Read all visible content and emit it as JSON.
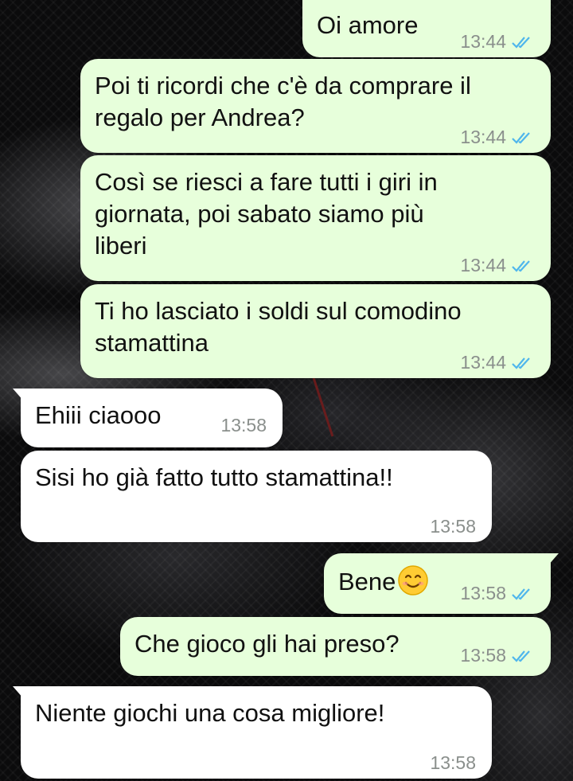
{
  "colors": {
    "outgoing_bubble": "#e7ffdb",
    "incoming_bubble": "#ffffff",
    "read_ticks": "#4fb6ec",
    "timestamp": "#8a8f8c"
  },
  "messages": [
    {
      "id": "m1",
      "direction": "outgoing",
      "text": "Oi amore",
      "time": "13:44",
      "status_icon": "double-check-read-icon"
    },
    {
      "id": "m2",
      "direction": "outgoing",
      "lines": [
        "Poi ti ricordi che c'è da comprare il",
        "regalo per Andrea?"
      ],
      "time": "13:44",
      "status_icon": "double-check-read-icon"
    },
    {
      "id": "m3",
      "direction": "outgoing",
      "lines": [
        "Così se riesci a fare tutti i giri in",
        "giornata, poi sabato siamo più",
        "liberi"
      ],
      "time": "13:44",
      "status_icon": "double-check-read-icon"
    },
    {
      "id": "m4",
      "direction": "outgoing",
      "lines": [
        "Ti ho lasciato i soldi sul comodino",
        "stamattina"
      ],
      "time": "13:44",
      "status_icon": "double-check-read-icon"
    },
    {
      "id": "m5",
      "direction": "incoming",
      "text": "Ehiii ciaooo",
      "time": "13:58"
    },
    {
      "id": "m6",
      "direction": "incoming",
      "text": "Sisi ho già fatto tutto stamattina!!",
      "time": "13:58"
    },
    {
      "id": "m7",
      "direction": "outgoing",
      "text": "Bene",
      "emoji": "smiling-face-icon",
      "time": "13:58",
      "status_icon": "double-check-read-icon"
    },
    {
      "id": "m8",
      "direction": "outgoing",
      "text": "Che gioco gli hai preso?",
      "time": "13:58",
      "status_icon": "double-check-read-icon"
    },
    {
      "id": "m9",
      "direction": "incoming",
      "text": "Niente giochi una cosa migliore!",
      "time": "13:58"
    }
  ]
}
